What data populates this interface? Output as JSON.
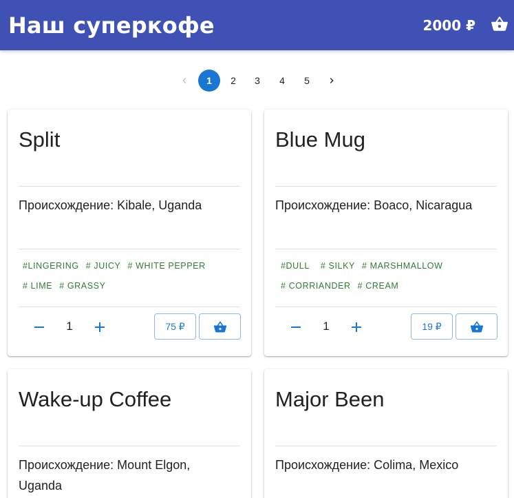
{
  "app": {
    "title": "Наш суперкофе",
    "cart_total": "2000 ₽",
    "basket_icon": "basket-icon",
    "bar_color": "#3f51b5"
  },
  "pagination": {
    "pages": [
      "1",
      "2",
      "3",
      "4",
      "5"
    ],
    "active_page": "1",
    "prev_icon": "chevron-left-icon",
    "next_icon": "chevron-right-icon",
    "accent": "#1976d2"
  },
  "products": [
    {
      "name": "Split",
      "origin": "Происхождение: Kibale, Uganda",
      "tags": [
        "#LINGERING",
        "# JUICY",
        "# WHITE PEPPER",
        "# LIME",
        "# GRASSY"
      ],
      "quantity": "1",
      "price": "75 ₽"
    },
    {
      "name": "Blue Mug",
      "origin": "Происхождение: Boaco, Nicaragua",
      "tags": [
        "#DULL",
        "# SILKY",
        "# MARSHMALLOW",
        "# CORRIANDER",
        "# CREAM"
      ],
      "quantity": "1",
      "price": "19 ₽"
    },
    {
      "name": "Wake-up Coffee",
      "origin": "Происхождение: Mount Elgon, Uganda"
    },
    {
      "name": "Major Been",
      "origin": "Происхождение: Colima, Mexico"
    }
  ],
  "tag_color": "#2e7d32"
}
